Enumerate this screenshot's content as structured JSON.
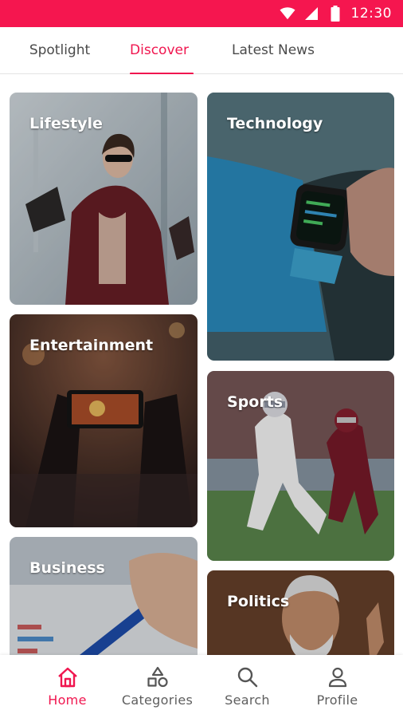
{
  "status_bar": {
    "time": "12:30",
    "icons": [
      "wifi-icon",
      "signal-icon",
      "battery-icon"
    ]
  },
  "tabs": [
    {
      "label": "Spotlight",
      "active": false
    },
    {
      "label": "Discover",
      "active": true
    },
    {
      "label": "Latest News",
      "active": false
    }
  ],
  "categories": [
    {
      "label": "Lifestyle"
    },
    {
      "label": "Technology"
    },
    {
      "label": "Entertainment"
    },
    {
      "label": "Sports"
    },
    {
      "label": "Business"
    },
    {
      "label": "Politics"
    }
  ],
  "bottom_nav": [
    {
      "label": "Home",
      "icon": "home-icon",
      "active": true
    },
    {
      "label": "Categories",
      "icon": "categories-icon",
      "active": false
    },
    {
      "label": "Search",
      "icon": "search-icon",
      "active": false
    },
    {
      "label": "Profile",
      "icon": "profile-icon",
      "active": false
    }
  ],
  "colors": {
    "accent": "#f0164f",
    "status_bar": "#f5164f",
    "inactive_text": "#5e5e5e"
  }
}
